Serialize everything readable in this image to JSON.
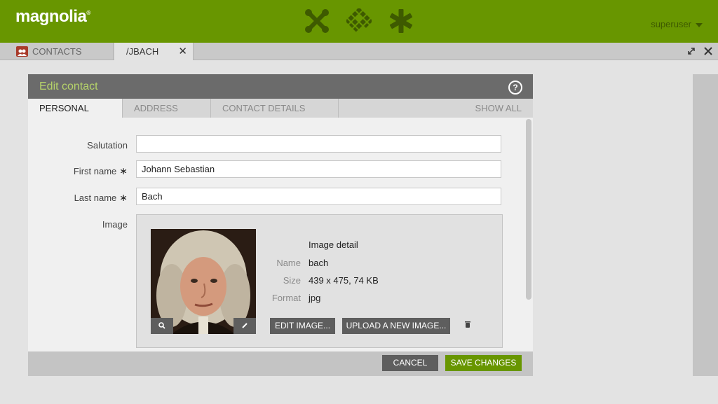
{
  "header": {
    "logo": "magnolia",
    "logo_mark": "®",
    "app_icons": [
      "tools-icon",
      "grid-diamond-icon",
      "asterisk-icon"
    ],
    "user": "superuser"
  },
  "tabs": [
    {
      "label": "CONTACTS",
      "icon": "contacts-icon"
    },
    {
      "label": "/JBACH",
      "close": "✕"
    }
  ],
  "dialog": {
    "title": "Edit contact",
    "help": "?",
    "tabs": [
      "PERSONAL",
      "ADDRESS",
      "CONTACT DETAILS",
      "SHOW ALL"
    ],
    "fields": {
      "salutation": {
        "label": "Salutation",
        "value": ""
      },
      "first_name": {
        "label": "First name",
        "value": "Johann Sebastian",
        "required": "∗"
      },
      "last_name": {
        "label": "Last name",
        "value": "Bach",
        "required": "∗"
      },
      "image_label": "Image"
    },
    "image": {
      "heading": "Image detail",
      "name_key": "Name",
      "name_val": "bach",
      "size_key": "Size",
      "size_val": "439 x 475, 74 KB",
      "format_key": "Format",
      "format_val": "jpg",
      "edit_btn": "EDIT IMAGE...",
      "upload_btn": "UPLOAD A NEW IMAGE..."
    },
    "footer": {
      "cancel": "CANCEL",
      "save": "SAVE CHANGES"
    }
  },
  "colors": {
    "brand_green": "#689600",
    "title_green": "#b6d36a",
    "dark_button": "#5e5e5e",
    "save_green": "#689600"
  }
}
